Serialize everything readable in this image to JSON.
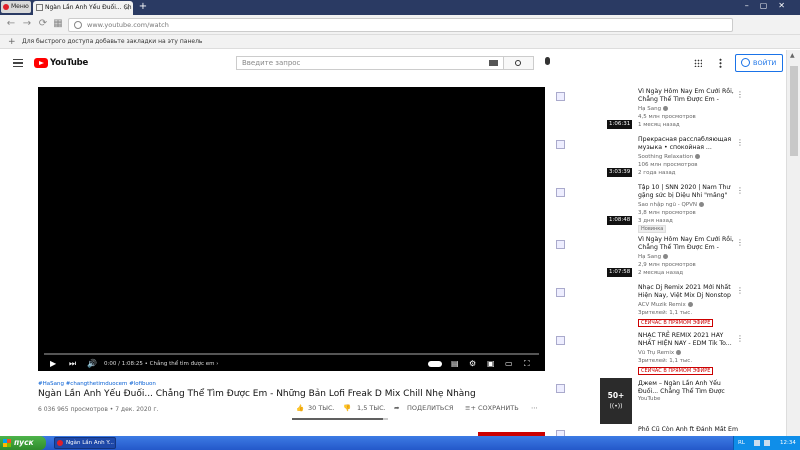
{
  "browser": {
    "menu_label": "Меню",
    "tab_title": "Ngàn Lần Anh Yếu Đuối... Ch",
    "tab_close": "×",
    "new_tab": "+",
    "url": "www.youtube.com/watch",
    "bookmarks_hint": "Для быстрого доступа добавьте закладки на эту панель",
    "bookmarks_add": "+",
    "back": "←",
    "forward": "→",
    "reload": "⟳",
    "grid": "▦",
    "window_controls": "–▢✕"
  },
  "youtube": {
    "logo_text": "YouTube",
    "search_placeholder": "Введите запрос",
    "signin_label": "ВОЙТИ"
  },
  "player": {
    "time": "0:00 / 1:08:25",
    "chapter": "• Chẳng thể tìm được em ›",
    "progress": 0,
    "ctl_play": "▶",
    "ctl_next": "⏭",
    "ctl_volume": "🔊",
    "ctl_subtitles": "▤",
    "ctl_settings": "⚙",
    "ctl_miniplayer": "▣",
    "ctl_theater": "▭",
    "ctl_fullscreen": "⛶"
  },
  "video": {
    "hashtags": "#HaSang #changthetimduocem #lofibuon",
    "title": "Ngàn Lần Anh Yếu Đuối... Chẳng Thể Tìm Được Em - Những Bản Lofi Freak D Mix Chill Nhẹ Nhàng",
    "meta": "6 036 965 просмотров • 7 дек. 2020 г.",
    "likes": "30 ТЫС.",
    "dislikes": "1,5 ТЫС.",
    "share": "ПОДЕЛИТЬСЯ",
    "save": "СОХРАНИТЬ",
    "more": "⋯",
    "like_ratio": 0.95
  },
  "recommendations": [
    {
      "title": "Vì Ngày Hôm Nay Em Cưới Rồi, Chẳng Thể Tìm Được Em -",
      "channel": "Hạ Sang",
      "stats": "4,5 млн просмотров",
      "stats2": "1 месяц назад",
      "duration": "1:06:31",
      "badge": ""
    },
    {
      "title": "Прекрасная расслабляющая музыка • спокойная ...",
      "channel": "Soothing Relaxation",
      "stats": "106 млн просмотров",
      "stats2": "2 года назад",
      "duration": "3:03:39",
      "badge": ""
    },
    {
      "title": "Tập 10 | SNN 2020 | Nam Thư gặng sức bị Diệu Nhi \"măng\"",
      "channel": "Sao nhập ngũ - QPVN",
      "stats": "3,8 млн просмотров",
      "stats2": "3 дня назад",
      "duration": "1:08:48",
      "badge": "Новинка"
    },
    {
      "title": "Vì Ngày Hôm Nay Em Cưới Rồi, Chẳng Thể Tìm Được Em -",
      "channel": "Hạ Sang",
      "stats": "2,9 млн просмотров",
      "stats2": "2 месяца назад",
      "duration": "1:07:58",
      "badge": ""
    },
    {
      "title": "Nhạc Dj Remix 2021 Mới Nhất Hiện Nay, Việt Mix Dj Nonstop",
      "channel": "ACV Muzik Remix",
      "stats": "Зрителей: 1,1 тыс.",
      "stats2": "",
      "duration": "",
      "badge": "СЕЙЧАС В ПРЯМОМ ЭФИРЕ"
    },
    {
      "title": "NHẠC TRẺ REMIX 2021 HAY NHẤT HIỆN NAY - EDM Tik To...",
      "channel": "Vũ Trụ Remix",
      "stats": "Зрителей: 1,1 тыс.",
      "stats2": "",
      "duration": "",
      "badge": "СЕЙЧАС В ПРЯМОМ ЭФИРЕ"
    },
    {
      "title": "Джем – Ngàn Lần Anh Yếu Đuối... Chẳng Thể Tìm Được",
      "channel": "YouTube",
      "stats": "",
      "stats2": "",
      "duration": "",
      "badge": "",
      "mix_count": "50+",
      "mix_icon": "((•))"
    },
    {
      "title": "Phố Cũ Còn Anh ft Đánh Mất Em",
      "channel": "",
      "stats": "",
      "stats2": "",
      "duration": "",
      "badge": ""
    }
  ],
  "taskbar": {
    "start": "пуск",
    "task": "Ngàn Lần Anh Y...",
    "lang": "RL",
    "clock": "12:34"
  }
}
